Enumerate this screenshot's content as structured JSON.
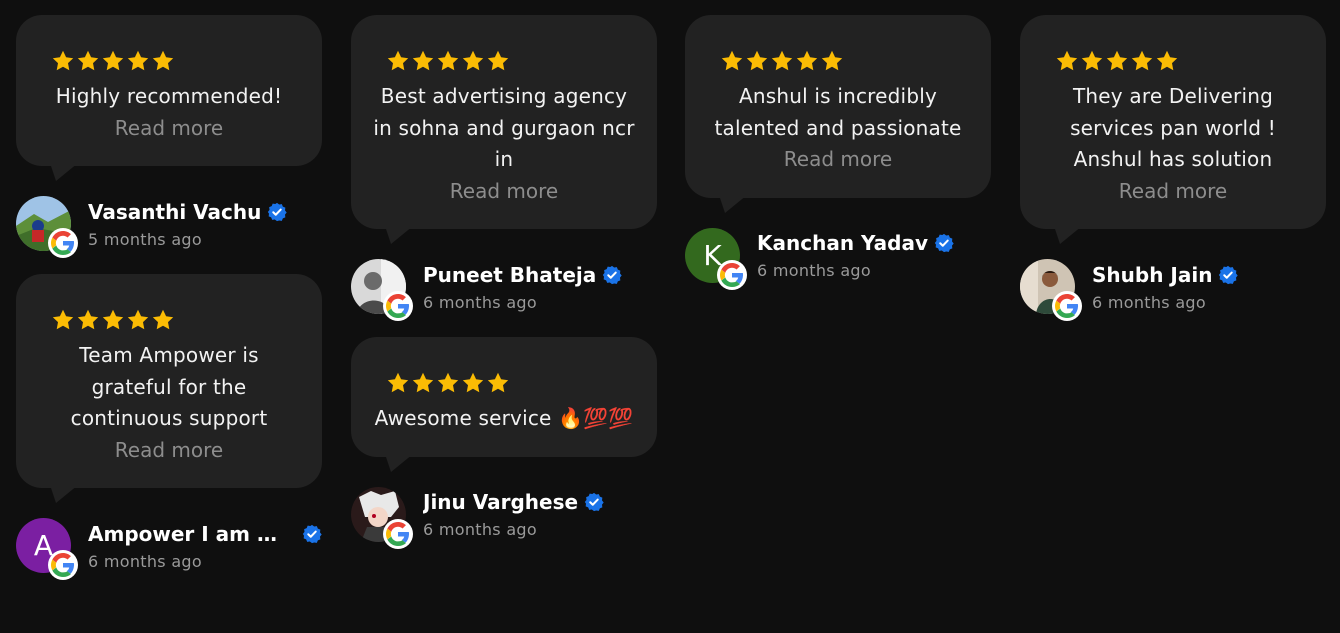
{
  "colors": {
    "background": "#0f0f0f",
    "card": "#222222",
    "star": "#fbbc04",
    "verified": "#1a73e8",
    "read_more": "#8d8d8d",
    "date": "#9a9a9a"
  },
  "reviews": [
    {
      "rating": 5,
      "text": "Highly recommended!",
      "read_more": "Read more",
      "author": "Vasanthi Vachu",
      "date": "5 months ago",
      "avatar": "photo-landscape"
    },
    {
      "rating": 5,
      "text": "Team Ampower is grateful for the continuous support",
      "read_more": "Read more",
      "author": "Ampower I am Po...",
      "date": "6 months ago",
      "avatar_letter": "A",
      "avatar_color": "#7b1fa2"
    },
    {
      "rating": 5,
      "text": "Best advertising agency in sohna and gurgaon ncr in",
      "read_more": "Read more",
      "author": "Puneet Bhateja",
      "date": "6 months ago",
      "avatar": "photo-grayscale"
    },
    {
      "rating": 5,
      "text": "Awesome service 🔥💯💯",
      "author": "Jinu Varghese",
      "date": "6 months ago",
      "avatar": "photo-anime"
    },
    {
      "rating": 5,
      "text": "Anshul is incredibly talented and passionate",
      "read_more": "Read more",
      "author": "Kanchan Yadav",
      "date": "6 months ago",
      "avatar_letter": "K",
      "avatar_color": "#33691e"
    },
    {
      "rating": 5,
      "text": "They are Delivering services pan world ! Anshul has solution",
      "read_more": "Read more",
      "author": "Shubh Jain",
      "date": "6 months ago",
      "avatar": "photo-person"
    }
  ],
  "icons": {
    "star": "star-icon",
    "verified": "verified-badge-icon",
    "google": "google-g-icon"
  }
}
